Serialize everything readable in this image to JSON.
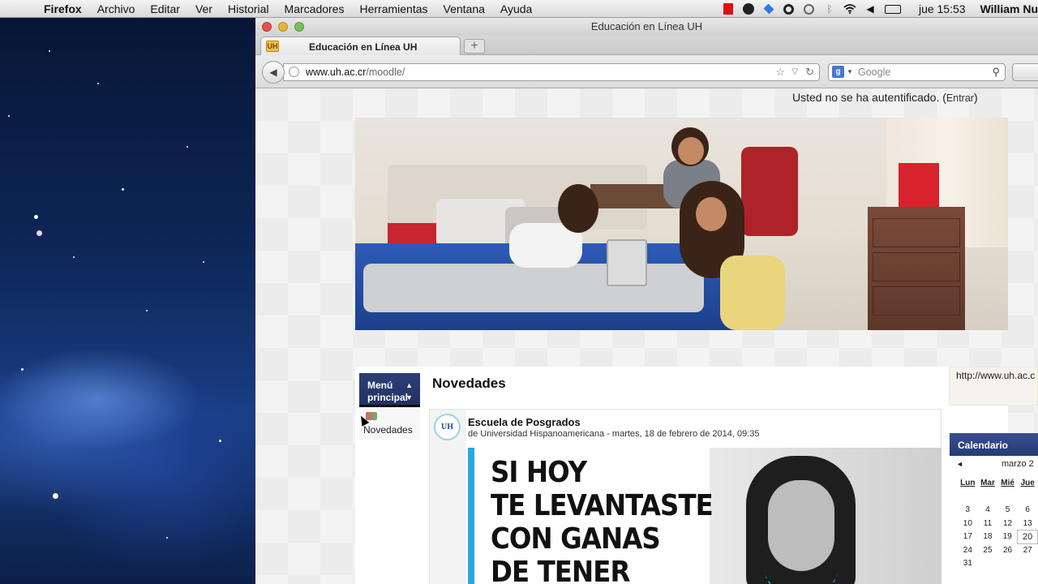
{
  "menubar": {
    "app_name": "Firefox",
    "items": [
      "Archivo",
      "Editar",
      "Ver",
      "Historial",
      "Marcadores",
      "Herramientas",
      "Ventana",
      "Ayuda"
    ],
    "clock": "jue 15:53",
    "user": "William Nu"
  },
  "window": {
    "title": "Educación en Línea UH"
  },
  "tab": {
    "title": "Educación en Línea UH"
  },
  "url": {
    "host": "www.uh.ac.cr",
    "path": "/moodle/"
  },
  "search": {
    "placeholder": "Google"
  },
  "auth": {
    "message": "Usted no se ha autentificado. (",
    "login_link": "Entrar",
    "close_paren": ")"
  },
  "menu_block": {
    "title_line1": "Menú",
    "title_line2": "principal",
    "item": "Novedades"
  },
  "main": {
    "heading": "Novedades",
    "post": {
      "avatar_text": "UH",
      "title": "Escuela de Posgrados",
      "meta": "de Universidad Hispanoamericana - martes, 18 de febrero de 2014, 09:35",
      "poster_lines": [
        "SI HOY",
        "TE LEVANTASTE",
        "CON GANAS",
        "DE TENER"
      ]
    }
  },
  "right_panel": {
    "url_text": "http://www.uh.ac.c"
  },
  "calendar": {
    "title": "Calendario",
    "month": "marzo 2",
    "prev_label": "◄",
    "days": [
      "Lun",
      "Mar",
      "Mié",
      "Jue"
    ],
    "weeks": [
      [
        "",
        "",
        "",
        ""
      ],
      [
        "3",
        "4",
        "5",
        "6"
      ],
      [
        "10",
        "11",
        "12",
        "13"
      ],
      [
        "17",
        "18",
        "19",
        "20"
      ],
      [
        "24",
        "25",
        "26",
        "27"
      ],
      [
        "31",
        "",
        "",
        ""
      ]
    ],
    "today": "20"
  }
}
